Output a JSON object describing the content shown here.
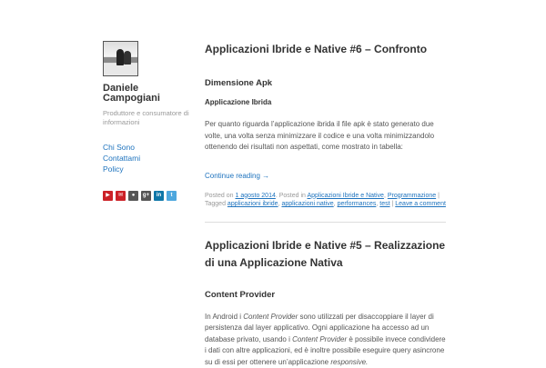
{
  "sidebar": {
    "author_name": "Daniele Campogiani",
    "tagline": "Produttore e consumatore di informazioni",
    "nav": [
      "Chi Sono",
      "Contattami",
      "Policy"
    ],
    "social": [
      {
        "name": "youtube",
        "glyph": "▶",
        "color": "#cc2127"
      },
      {
        "name": "email",
        "glyph": "✉",
        "color": "#cc2127"
      },
      {
        "name": "github",
        "glyph": "●",
        "color": "#555555"
      },
      {
        "name": "google-plus",
        "glyph": "g+",
        "color": "#555555"
      },
      {
        "name": "linkedin",
        "glyph": "in",
        "color": "#0e76a8"
      },
      {
        "name": "twitter",
        "glyph": "t",
        "color": "#4da7de"
      }
    ]
  },
  "post1": {
    "title": "Applicazioni Ibride e Native #6 – Confronto",
    "section": "Dimensione Apk",
    "subsection": "Applicazione Ibrida",
    "paragraph": "Per quanto riguarda l’applicazione ibrida il file apk è stato generato due volte, una volta senza minimizzare il codice e una volta minimizzandolo ottenendo dei risultati non aspettati, come mostrato in tabella:",
    "more": "Continue reading →",
    "meta": {
      "posted_on": "Posted on",
      "date": "1 agosto 2014",
      "posted_in": ". Posted in",
      "categories": [
        "Applicazioni Ibride e Native",
        "Programmazione"
      ],
      "tagged": "Tagged",
      "tags": [
        "applicazioni ibride",
        "applicazioni native",
        "performances",
        "test"
      ],
      "comment": "Leave a comment"
    }
  },
  "post2": {
    "title": "Applicazioni Ibride e Native #5 – Realizzazione di una Applicazione Nativa",
    "section": "Content Provider",
    "p_1": "In Android i",
    "em_1": "Content Provider",
    "p_2": "sono utilizzati per disaccoppiare il layer di persistenza dal layer applicativo. Ogni applicazione ha accesso ad un database privato, usando i",
    "em_2": "Content Provider",
    "p_3": "è possibile invece condividere i dati con altre applicazioni, ed è inoltre possibile eseguire query asincrone su di essi per ottenere un’applicazione",
    "em_3": "responsive."
  }
}
